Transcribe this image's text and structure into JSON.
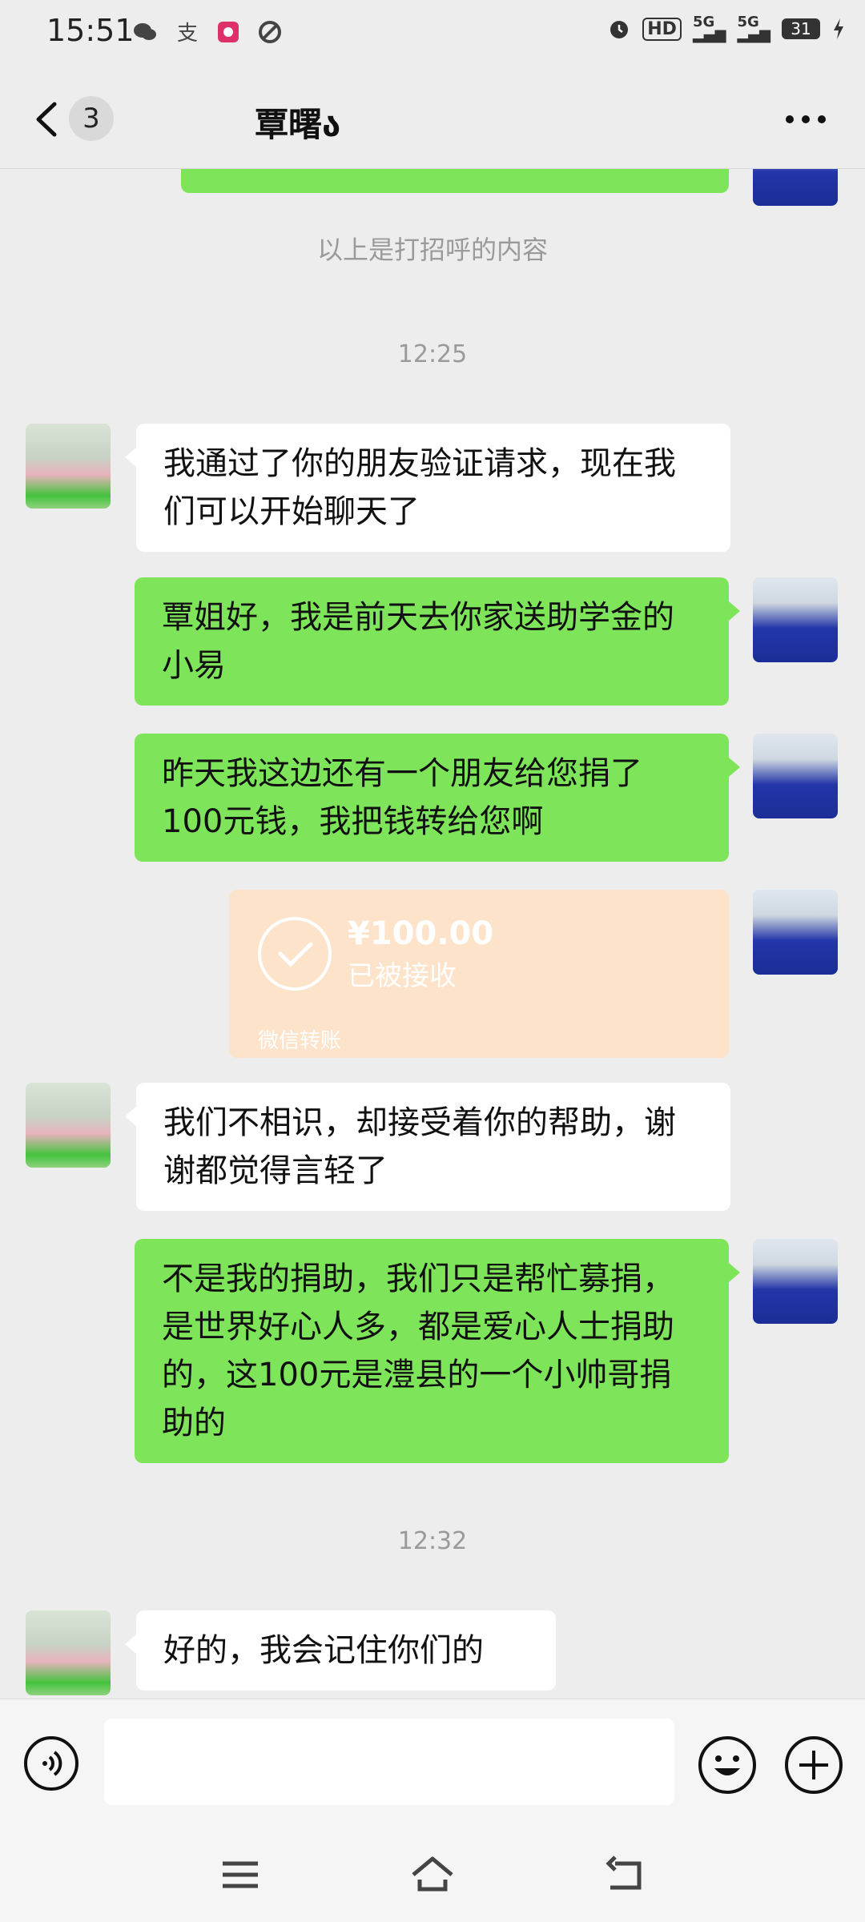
{
  "status_bar": {
    "time": "15:51",
    "left_icons": [
      "wechat-icon",
      "alipay-icon",
      "app-icon",
      "link-icon"
    ],
    "hd_label": "HD",
    "net1": "5G",
    "net2": "5G",
    "battery": "31"
  },
  "header": {
    "unread_count": "3",
    "title": "覃曙ა"
  },
  "chat": {
    "system_notice": "以上是打招呼的内容",
    "time1": "12:25",
    "messages": [
      {
        "side": "left",
        "text": "我通过了你的朋友验证请求，现在我们可以开始聊天了"
      },
      {
        "side": "right",
        "text": "覃姐好，我是前天去你家送助学金的小易"
      },
      {
        "side": "right",
        "text": "昨天我这边还有一个朋友给您捐了100元钱，我把钱转给您啊"
      },
      {
        "side": "left",
        "text": "我们不相识，却接受着你的帮助，谢谢都觉得言轻了"
      },
      {
        "side": "right",
        "text": "不是我的捐助，我们只是帮忙募捐，是世界好心人多，都是爱心人士捐助的，这100元是澧县的一个小帅哥捐助的"
      },
      {
        "side": "left",
        "text": "好的，我会记住你们的"
      }
    ],
    "transfer": {
      "amount": "¥100.00",
      "status": "已被接收",
      "footer": "微信转账"
    },
    "time2": "12:32"
  },
  "colors": {
    "background": "#ededed",
    "green_bubble": "#7ee55b",
    "white_bubble": "#ffffff",
    "transfer": "#fde3c9"
  }
}
